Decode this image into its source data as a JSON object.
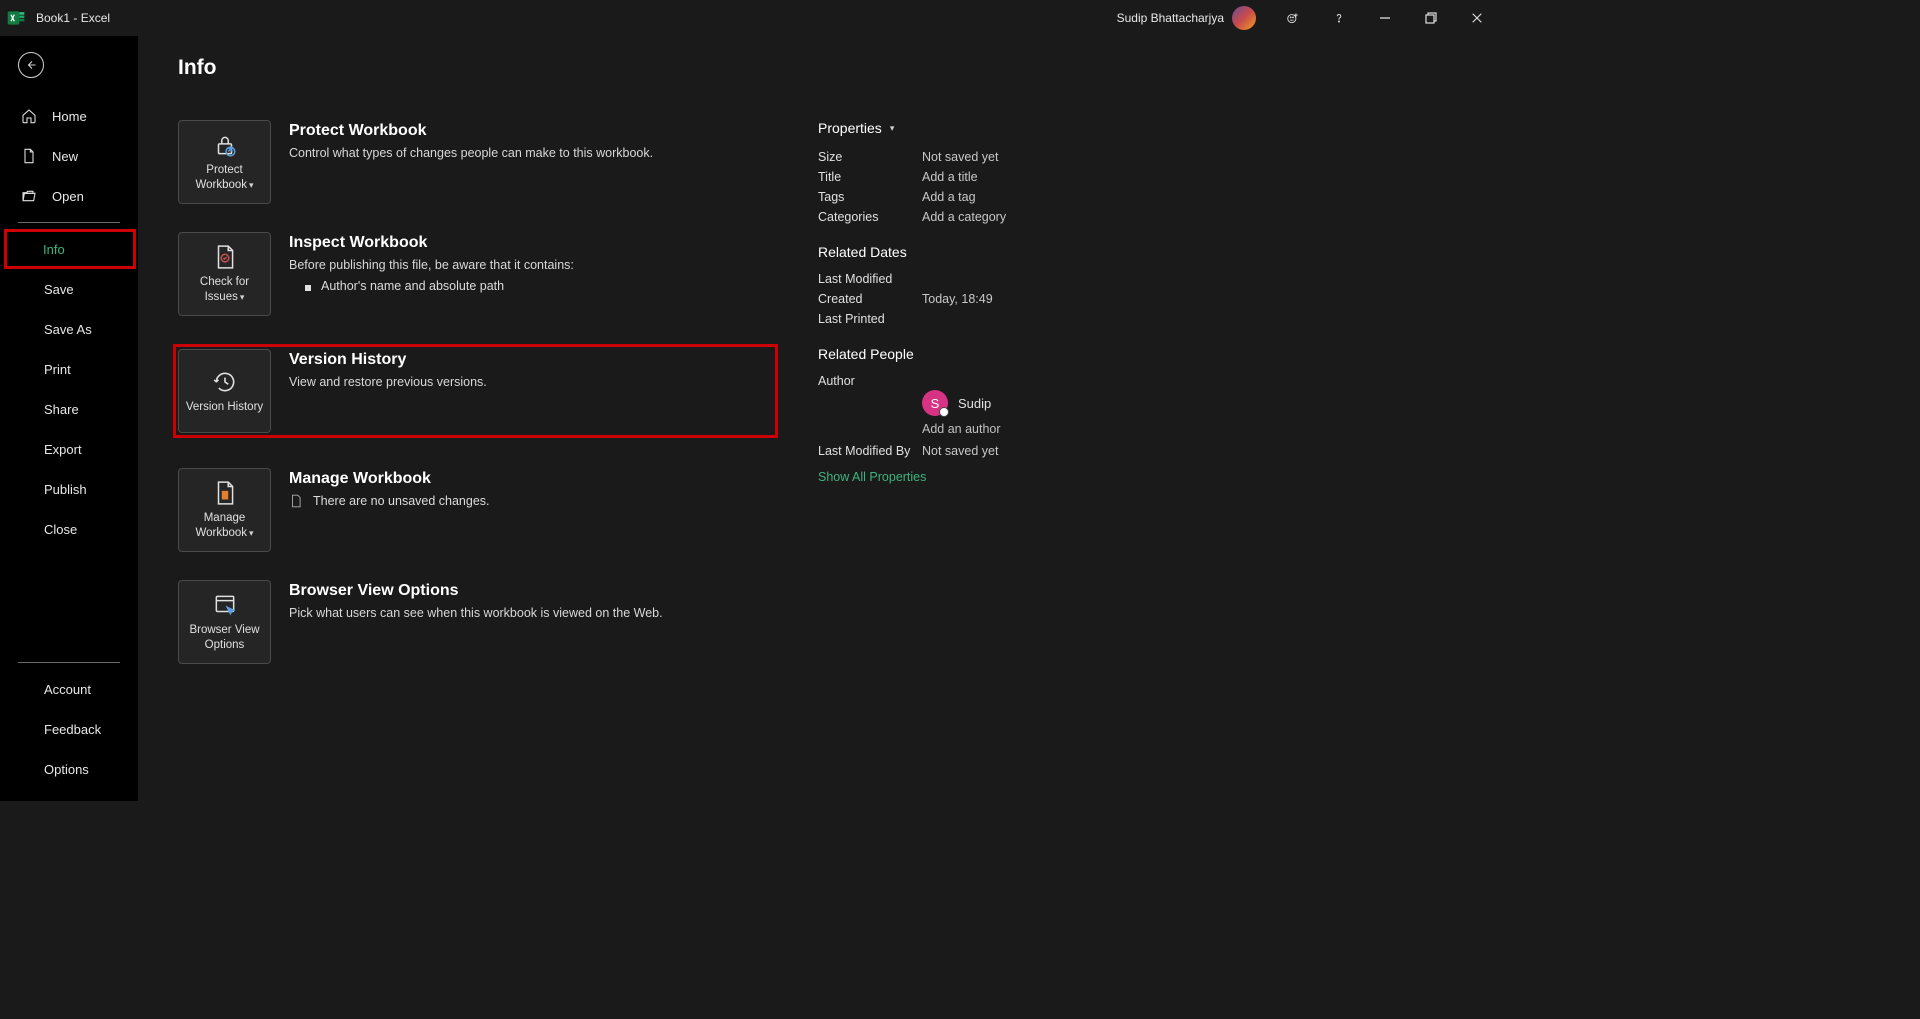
{
  "titlebar": {
    "title": "Book1  -  Excel",
    "user": "Sudip Bhattacharjya"
  },
  "sidebar": {
    "home": "Home",
    "new": "New",
    "open": "Open",
    "info": "Info",
    "save": "Save",
    "saveas": "Save As",
    "print": "Print",
    "share": "Share",
    "export": "Export",
    "publish": "Publish",
    "close": "Close",
    "account": "Account",
    "feedback": "Feedback",
    "options": "Options"
  },
  "page": {
    "title": "Info"
  },
  "sections": {
    "protect": {
      "btn": "Protect Workbook",
      "title": "Protect Workbook",
      "desc": "Control what types of changes people can make to this workbook."
    },
    "inspect": {
      "btn": "Check for Issues",
      "title": "Inspect Workbook",
      "desc": "Before publishing this file, be aware that it contains:",
      "bullet1": "Author's name and absolute path"
    },
    "version": {
      "btn": "Version History",
      "title": "Version History",
      "desc": "View and restore previous versions."
    },
    "manage": {
      "btn": "Manage Workbook",
      "title": "Manage Workbook",
      "desc": "There are no unsaved changes."
    },
    "browser": {
      "btn": "Browser View Options",
      "title": "Browser View Options",
      "desc": "Pick what users can see when this workbook is viewed on the Web."
    }
  },
  "props": {
    "header": "Properties",
    "size_l": "Size",
    "size_v": "Not saved yet",
    "title_l": "Title",
    "title_v": "Add a title",
    "tags_l": "Tags",
    "tags_v": "Add a tag",
    "cat_l": "Categories",
    "cat_v": "Add a category",
    "dates_h": "Related Dates",
    "lm_l": "Last Modified",
    "lm_v": "",
    "cr_l": "Created",
    "cr_v": "Today, 18:49",
    "lp_l": "Last Printed",
    "lp_v": "",
    "people_h": "Related People",
    "author_l": "Author",
    "author_name": "Sudip",
    "author_initial": "S",
    "add_author": "Add an author",
    "lmb_l": "Last Modified By",
    "lmb_v": "Not saved yet",
    "show_all": "Show All Properties"
  }
}
